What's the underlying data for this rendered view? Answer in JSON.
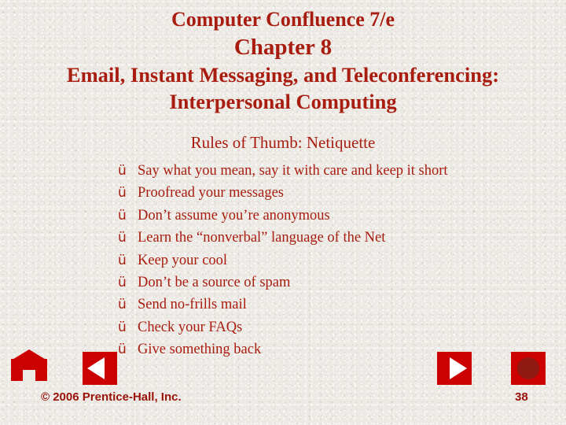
{
  "slide": {
    "title": {
      "line1": "Computer Confluence 7/e",
      "line2": "Chapter 8",
      "line3": "Email, Instant Messaging, and Teleconferencing:",
      "line4": "Interpersonal Computing"
    },
    "subtitle": "Rules of Thumb: Netiquette",
    "bullet_marker": "ü",
    "bullets": [
      "Say what you mean, say it with care and keep it short",
      "Proofread your messages",
      "Don’t assume you’re anonymous",
      "Learn the “nonverbal” language of the Net",
      "Keep your cool",
      "Don’t be a source of spam",
      "Send no-frills mail",
      "Check your FAQs",
      "Give something back"
    ],
    "footer": "© 2006 Prentice-Hall, Inc.",
    "page_number": "38",
    "colors": {
      "text_red": "#a81d0f",
      "nav_red": "#cc0000",
      "background": "#edeae5"
    }
  }
}
